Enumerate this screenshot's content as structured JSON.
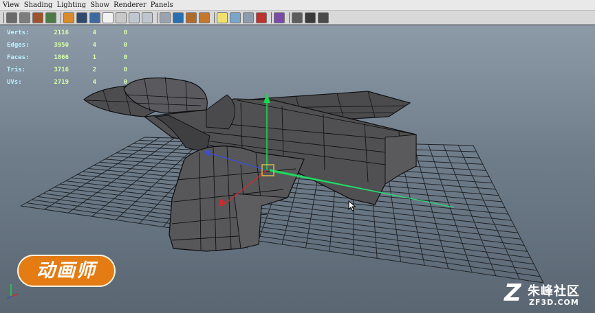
{
  "menu": {
    "items": [
      "View",
      "Shading",
      "Lighting",
      "Show",
      "Renderer",
      "Panels"
    ]
  },
  "toolbar": {
    "icons": [
      "camera-attributes-icon",
      "bookmark-icon",
      "image-plane-icon",
      "2d-pan-icon",
      "grid-icon",
      "film-gate-icon",
      "resolution-gate-icon",
      "gate-mask-icon",
      "field-chart-icon",
      "safe-action-icon",
      "safe-title-icon",
      "wireframe-icon",
      "smooth-shade-icon",
      "default-material-icon",
      "textured-icon",
      "lights-icon",
      "shadows-icon",
      "ambient-occlusion-icon",
      "xray-icon",
      "isolate-select-icon",
      "high-quality-icon",
      "hud-icon",
      "screen-space-icon"
    ],
    "colors": {
      "bar": "#d8d8d8",
      "icon": "#aab"
    }
  },
  "hud": {
    "rows": [
      {
        "label": "Verts:",
        "v1": "2116",
        "v2": "4",
        "v3": "0"
      },
      {
        "label": "Edges:",
        "v1": "3950",
        "v2": "4",
        "v3": "0"
      },
      {
        "label": "Faces:",
        "v1": "1866",
        "v2": "1",
        "v3": "0"
      },
      {
        "label": "Tris:",
        "v1": "3716",
        "v2": "2",
        "v3": "0"
      },
      {
        "label": "UVs:",
        "v1": "2719",
        "v2": "4",
        "v3": "0"
      }
    ]
  },
  "viewport": {
    "colors": {
      "background_top": "#8d9aa8",
      "background_bottom": "#5a6672",
      "grid": "#1f2326",
      "mesh": "#4a4a4c",
      "wire": "#0f0f10",
      "x_axis": "#d02a2a",
      "y_axis": "#19d84a",
      "z_axis": "#3a4fd0",
      "pivot": "#e0c24a"
    },
    "grid_visible": true,
    "model": "jet-fighter-polygon-mesh"
  },
  "overlay": {
    "logo_text": "动画师",
    "watermark_glyph": "Z",
    "watermark_name": "朱峰社区",
    "watermark_url": "ZF3D.COM"
  }
}
